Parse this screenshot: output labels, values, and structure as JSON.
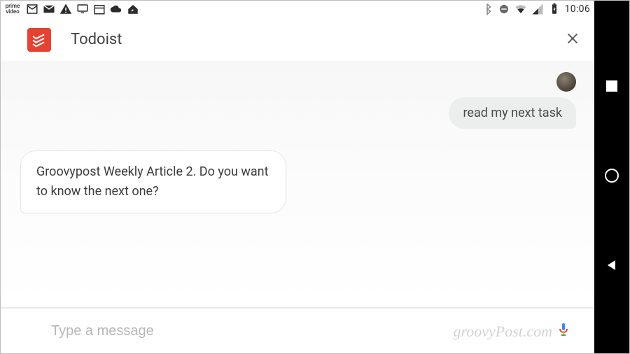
{
  "statusbar": {
    "time": "10:06",
    "left_icons": [
      "prime-video",
      "gmail",
      "mail",
      "warning",
      "monitor",
      "calendar",
      "cloud",
      "zillow"
    ],
    "right_icons": [
      "bluetooth",
      "do-not-disturb",
      "wifi",
      "cellular",
      "battery-charging"
    ]
  },
  "header": {
    "app_name": "Todoist",
    "close_label": "Close"
  },
  "chat": {
    "user_bubble": "read my next task",
    "assistant_bubble": "Groovypost Weekly Article 2. Do you want to know the next one?"
  },
  "input": {
    "placeholder": "Type a message"
  },
  "nav": {
    "recent": "Recent apps",
    "home": "Home",
    "back": "Back"
  },
  "watermark": "groovyPost.com"
}
